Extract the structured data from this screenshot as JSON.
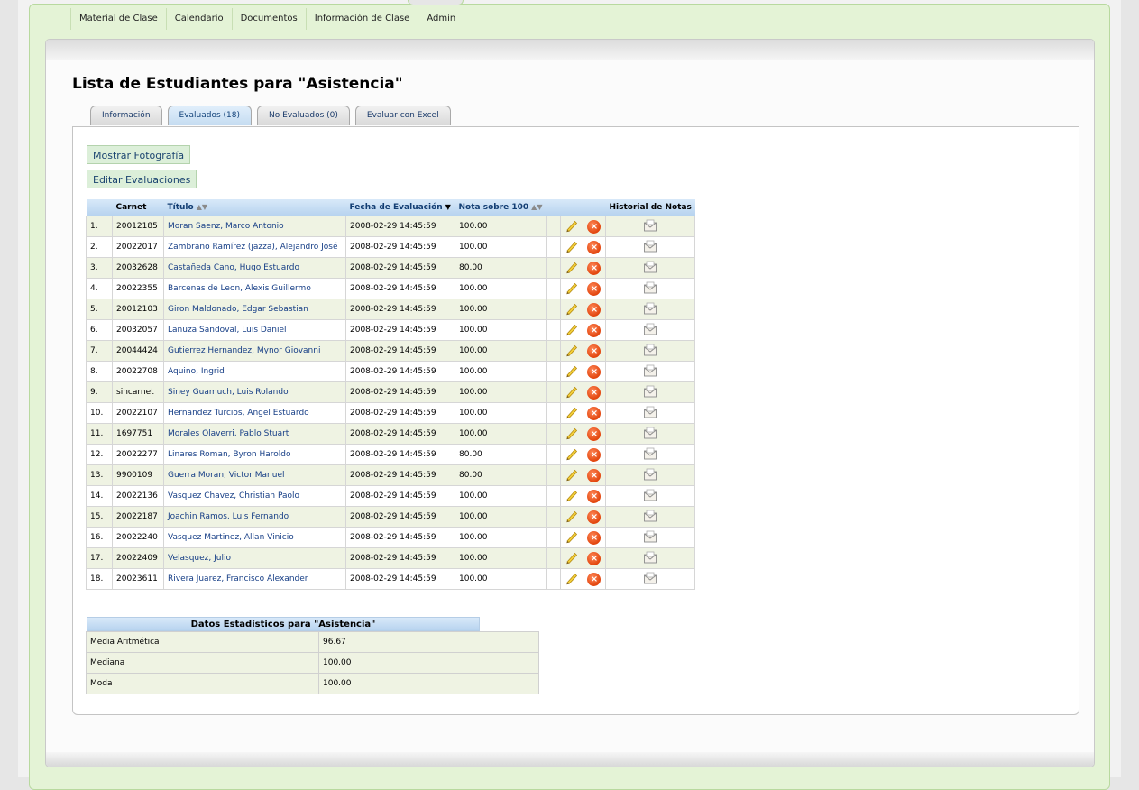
{
  "nav": {
    "items": [
      "Material de Clase",
      "Calendario",
      "Documentos",
      "Información de Clase",
      "Admin"
    ]
  },
  "page_title": "Lista de Estudiantes para \"Asistencia\"",
  "tabs": [
    {
      "label": "Información"
    },
    {
      "label": "Evaluados (18)"
    },
    {
      "label": "No Evaluados (0)"
    },
    {
      "label": "Evaluar con Excel"
    }
  ],
  "buttons": {
    "show_photo": "Mostrar Fotografía",
    "edit_evaluations": "Editar Evaluaciones"
  },
  "table": {
    "headers": {
      "carnet": "Carnet",
      "title": "Título",
      "date": "Fecha de Evaluación",
      "grade": "Nota sobre 100",
      "history": "Historial de Notas"
    },
    "rows": [
      {
        "num": "1.",
        "carnet": "20012185",
        "name": "Moran Saenz, Marco Antonio",
        "date": "2008-02-29 14:45:59",
        "grade": "100.00"
      },
      {
        "num": "2.",
        "carnet": "20022017",
        "name": "Zambrano Ramírez (jazza), Alejandro José",
        "date": "2008-02-29 14:45:59",
        "grade": "100.00"
      },
      {
        "num": "3.",
        "carnet": "20032628",
        "name": "Castañeda Cano, Hugo Estuardo",
        "date": "2008-02-29 14:45:59",
        "grade": "80.00"
      },
      {
        "num": "4.",
        "carnet": "20022355",
        "name": "Barcenas de Leon, Alexis Guillermo",
        "date": "2008-02-29 14:45:59",
        "grade": "100.00"
      },
      {
        "num": "5.",
        "carnet": "20012103",
        "name": "Giron Maldonado, Edgar Sebastian",
        "date": "2008-02-29 14:45:59",
        "grade": "100.00"
      },
      {
        "num": "6.",
        "carnet": "20032057",
        "name": "Lanuza Sandoval, Luis Daniel",
        "date": "2008-02-29 14:45:59",
        "grade": "100.00"
      },
      {
        "num": "7.",
        "carnet": "20044424",
        "name": "Gutierrez Hernandez, Mynor Giovanni",
        "date": "2008-02-29 14:45:59",
        "grade": "100.00"
      },
      {
        "num": "8.",
        "carnet": "20022708",
        "name": "Aquino, Ingrid",
        "date": "2008-02-29 14:45:59",
        "grade": "100.00"
      },
      {
        "num": "9.",
        "carnet": "sincarnet",
        "name": "Siney Guamuch, Luis Rolando",
        "date": "2008-02-29 14:45:59",
        "grade": "100.00"
      },
      {
        "num": "10.",
        "carnet": "20022107",
        "name": "Hernandez Turcios, Angel Estuardo",
        "date": "2008-02-29 14:45:59",
        "grade": "100.00"
      },
      {
        "num": "11.",
        "carnet": "1697751",
        "name": "Morales Olaverri, Pablo Stuart",
        "date": "2008-02-29 14:45:59",
        "grade": "100.00"
      },
      {
        "num": "12.",
        "carnet": "20022277",
        "name": "Linares Roman, Byron Haroldo",
        "date": "2008-02-29 14:45:59",
        "grade": "80.00"
      },
      {
        "num": "13.",
        "carnet": "9900109",
        "name": "Guerra Moran, Victor Manuel",
        "date": "2008-02-29 14:45:59",
        "grade": "80.00"
      },
      {
        "num": "14.",
        "carnet": "20022136",
        "name": "Vasquez Chavez, Christian Paolo",
        "date": "2008-02-29 14:45:59",
        "grade": "100.00"
      },
      {
        "num": "15.",
        "carnet": "20022187",
        "name": "Joachin Ramos, Luis Fernando",
        "date": "2008-02-29 14:45:59",
        "grade": "100.00"
      },
      {
        "num": "16.",
        "carnet": "20022240",
        "name": "Vasquez Martinez, Allan Vinicio",
        "date": "2008-02-29 14:45:59",
        "grade": "100.00"
      },
      {
        "num": "17.",
        "carnet": "20022409",
        "name": "Velasquez, Julio",
        "date": "2008-02-29 14:45:59",
        "grade": "100.00"
      },
      {
        "num": "18.",
        "carnet": "20023611",
        "name": "Rivera Juarez, Francisco Alexander",
        "date": "2008-02-29 14:45:59",
        "grade": "100.00"
      }
    ]
  },
  "stats": {
    "title": "Datos Estadísticos para \"Asistencia\"",
    "rows": [
      {
        "label": "Media Aritmética",
        "value": "96.67"
      },
      {
        "label": "Mediana",
        "value": "100.00"
      },
      {
        "label": "Moda",
        "value": "100.00"
      }
    ]
  },
  "colors": {
    "outer_green": "#e4f3d6",
    "header_blue": "#b7d3ef",
    "row_alt": "#eff3e3",
    "link": "#163e86",
    "delete": "#e2450d"
  }
}
